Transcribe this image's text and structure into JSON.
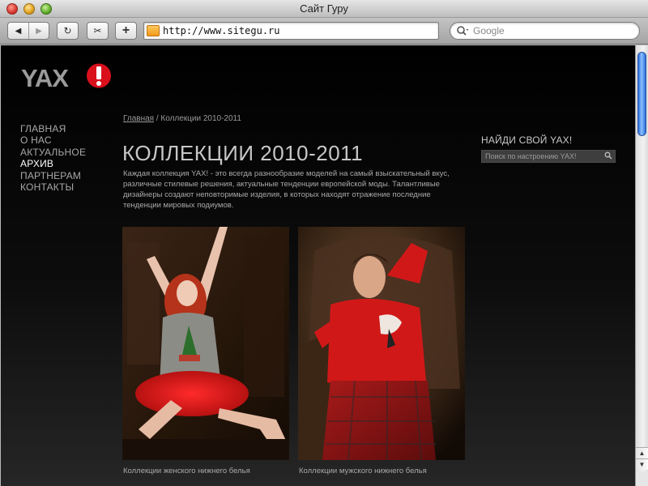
{
  "window": {
    "title": "Сайт Гуру"
  },
  "toolbar": {
    "back_icon": "◀",
    "forward_icon": "▶",
    "reload_icon": "↻",
    "snip_icon": "✂",
    "add_icon": "+",
    "url": "http://www.sitegu.ru",
    "search_placeholder": "Google"
  },
  "site": {
    "logo_text": "YAX!",
    "nav": [
      {
        "label": "ГЛАВНАЯ",
        "active": false
      },
      {
        "label": "О НАС",
        "active": false
      },
      {
        "label": "АКТУАЛЬНОЕ",
        "active": false
      },
      {
        "label": "АРХИВ",
        "active": true
      },
      {
        "label": "ПАРТНЕРАМ",
        "active": false
      },
      {
        "label": "КОНТАКТЫ",
        "active": false
      }
    ],
    "breadcrumb": {
      "home": "Главная",
      "separator": " / ",
      "current": "Коллекции 2010-2011"
    },
    "page_title": "КОЛЛЕКЦИИ 2010-2011",
    "intro": "Каждая коллекция YAX! - это всегда разнообразие моделей на самый взыскательный вкус, различные стилевые решения, актуальные тенденции европейской моды. Талантливые дизайнеры создают неповторимые изделия, в которых находят отражение последние тенденции мировых подиумов.",
    "collections": [
      {
        "caption": "Коллекции женского нижнего белья"
      },
      {
        "caption": "Коллекции мужского нижнего белья"
      }
    ],
    "sidebar": {
      "heading": "НАЙДИ СВОЙ YAX!",
      "search_placeholder": "Поиск по настроению YAX!"
    }
  },
  "colors": {
    "brand_red": "#d9101c",
    "logo_grey": "#9b9b9b",
    "page_bg": "#000000",
    "nav_text": "#a8a8a8",
    "nav_active": "#ffffff",
    "scroll_thumb": "#2b6ed8"
  },
  "icons": {
    "search": "magnifier-icon",
    "favicon": "folder-favicon-icon"
  }
}
